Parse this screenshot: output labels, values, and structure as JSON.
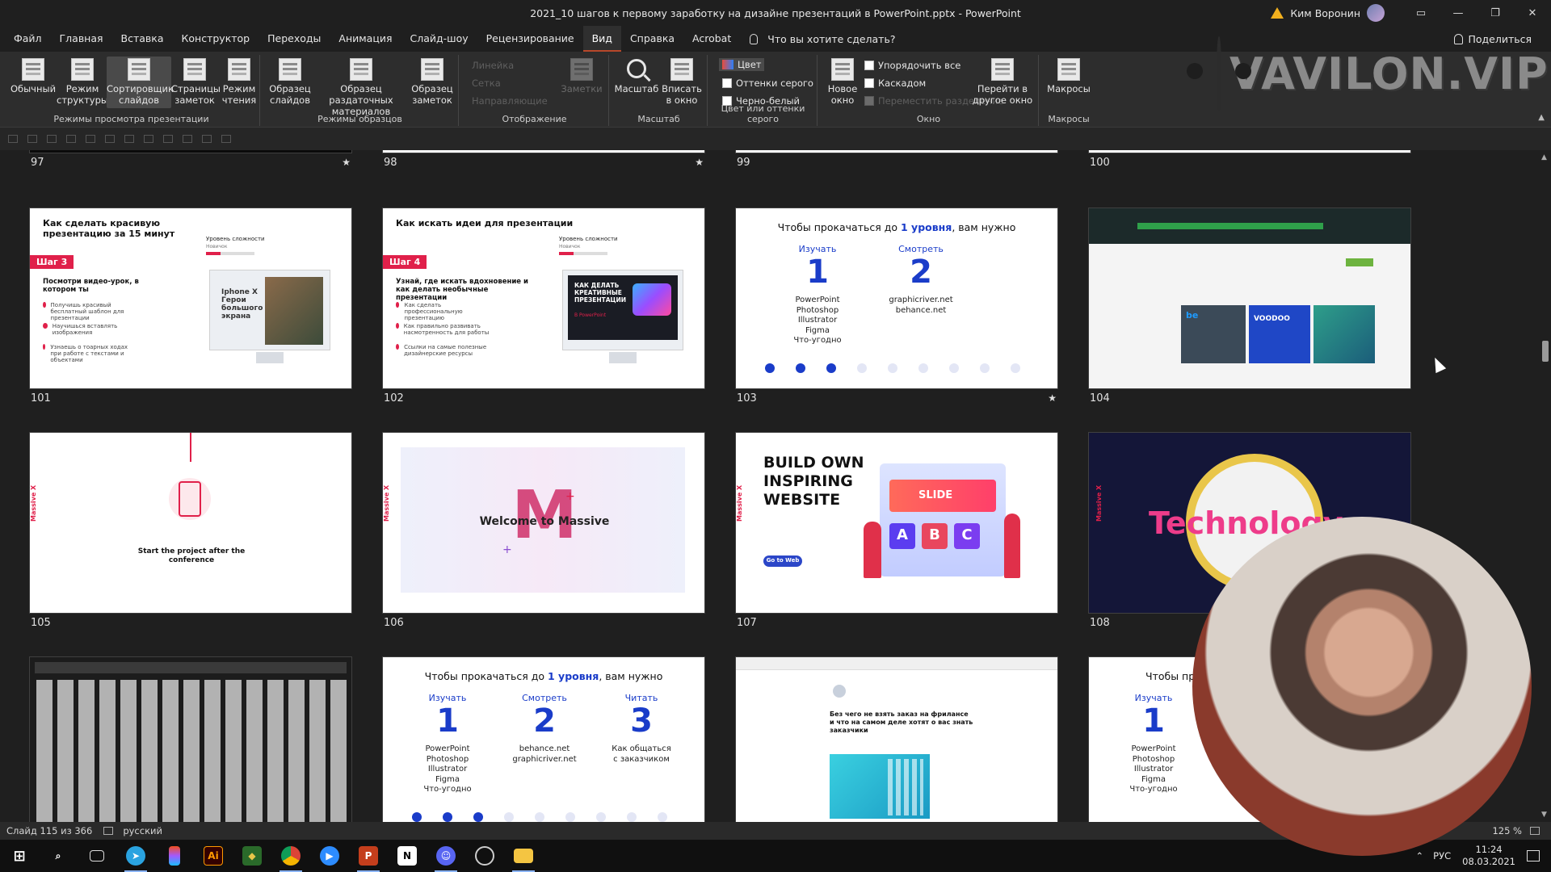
{
  "window": {
    "title": "2021_10 шагов к первому заработку на дизайне презентаций в PowerPoint.pptx - PowerPoint",
    "user_name": "Ким Воронин"
  },
  "menu": {
    "tabs": [
      "Файл",
      "Главная",
      "Вставка",
      "Конструктор",
      "Переходы",
      "Анимация",
      "Слайд-шоу",
      "Рецензирование",
      "Вид",
      "Справка",
      "Acrobat"
    ],
    "active_tab": "Вид",
    "tell_me": "Что вы хотите сделать?",
    "share": "Поделиться"
  },
  "ribbon": {
    "groups": {
      "presentation_views": "Режимы просмотра презентации",
      "master_views": "Режимы образцов",
      "show": "Отображение",
      "zoom": "Масштаб",
      "color": "Цвет или оттенки серого",
      "window": "Окно",
      "macros": "Макросы"
    },
    "buttons": {
      "normal": "Обычный",
      "outline": "Режим структуры",
      "sorter": "Сортировщик слайдов",
      "notes_page": "Страницы заметок",
      "reading": "Режим чтения",
      "slide_master": "Образец слайдов",
      "handout_master": "Образец раздаточных материалов",
      "notes_master": "Образец заметок",
      "ruler": "Линейка",
      "grid": "Сетка",
      "guides": "Направляющие",
      "notes": "Заметки",
      "zoom": "Масштаб",
      "fit": "Вписать в окно",
      "color": "Цвет",
      "grayscale": "Оттенки серого",
      "bw": "Черно-белый",
      "new_window": "Новое окно",
      "arrange_all": "Упорядочить все",
      "cascade": "Каскадом",
      "move_split": "Переместить разделение",
      "switch_windows": "Перейти в другое окно",
      "macros": "Макросы"
    }
  },
  "watermark": {
    "text": "VAVILON.VIP"
  },
  "slides": {
    "top_row": [
      {
        "num": "97",
        "star": "★"
      },
      {
        "num": "98",
        "star": "★"
      },
      {
        "num": "99",
        "star": ""
      },
      {
        "num": "100",
        "star": ""
      }
    ],
    "s101": {
      "num": "101",
      "title": "Как сделать красивую презентацию за 15 минут",
      "step": "Шаг 3",
      "subtitle": "Посмотри видео-урок, в котором ты",
      "bullets": [
        "Получишь красивый бесплатный шаблон для презентации",
        "Научишься вставлять изображения",
        "Узнаешь о тоарных ходах при работе с текстами и объектами"
      ],
      "difficulty": "Уровень сложности",
      "novice": "Новичок",
      "screen_title": "Iphone X Герои большого экрана"
    },
    "s102": {
      "num": "102",
      "title": "Как искать идеи для презентации",
      "step": "Шаг 4",
      "subtitle": "Узнай, где искать вдохновение и как делать необычные презентации",
      "bullets": [
        "Как сделать профессиональную презентацию",
        "Как правильно развивать насмотренность для работы",
        "Ссылки на самые полезные дизайнерские ресурсы"
      ],
      "difficulty": "Уровень сложности",
      "novice": "Новичок",
      "screen_title": "КАК ДЕЛАТЬ КРЕАТИВНЫЕ ПРЕЗЕНТАЦИИ",
      "screen_sub": "В PowerPoint"
    },
    "s103": {
      "num": "103",
      "star": "★",
      "title_pre": "Чтобы прокачаться до ",
      "title_hl": "1 уровня",
      "title_post": ", вам нужно",
      "cols": [
        {
          "head": "Изучать",
          "digit": "1",
          "lines": [
            "PowerPoint",
            "Photoshop",
            "Illustrator",
            "Figma",
            "Что-угодно"
          ]
        },
        {
          "head": "Смотреть",
          "digit": "2",
          "lines": [
            "graphicriver.net",
            "behance.net"
          ]
        }
      ]
    },
    "s104": {
      "num": "104",
      "tiles": [
        "be",
        "VOODOO"
      ]
    },
    "s105": {
      "num": "105",
      "brand": "Massive X",
      "title": "Start the project after the conference"
    },
    "s106": {
      "num": "106",
      "brand": "Massive X",
      "letter": "M",
      "title": "Welcome to Massive"
    },
    "s107": {
      "num": "107",
      "title": "BUILD OWN INSPIRING WEBSITE",
      "button": "Go to Web",
      "slide_label": "SLIDE",
      "letters": [
        "A",
        "B",
        "C"
      ]
    },
    "s108": {
      "num": "108",
      "brand": "Massive X",
      "title": "Technology"
    },
    "s110": {
      "title_pre": "Чтобы прокачаться до ",
      "title_hl": "1 уровня",
      "title_post": ", вам нужно",
      "cols": [
        {
          "head": "Изучать",
          "digit": "1",
          "lines": [
            "PowerPoint",
            "Photoshop",
            "Illustrator",
            "Figma",
            "Что-угодно"
          ]
        },
        {
          "head": "Смотреть",
          "digit": "2",
          "lines": [
            "behance.net",
            "graphicriver.net"
          ]
        },
        {
          "head": "Читать",
          "digit": "3",
          "lines": [
            "Как общаться",
            "с заказчиком"
          ]
        }
      ]
    },
    "s111": {
      "title": "Без чего не взять заказ на фрилансе и что на самом деле хотят о вас знать заказчики"
    },
    "s112": {
      "title_pre": "Чтобы прок",
      "cols": [
        {
          "head": "Изучать",
          "digit": "1",
          "lines": [
            "PowerPoint",
            "Photoshop",
            "Illustrator",
            "Figma",
            "Что-угодно"
          ]
        }
      ]
    }
  },
  "status": {
    "slide_info": "Слайд 115 из 366",
    "language": "русский",
    "zoom": "125 %"
  },
  "taskbar": {
    "lang": "РУС",
    "time": "11:24",
    "date": "08.03.2021"
  },
  "colors": {
    "accent": "#b7472a",
    "brand_red": "#e0204a",
    "blue_level": "#1a3cc9"
  }
}
